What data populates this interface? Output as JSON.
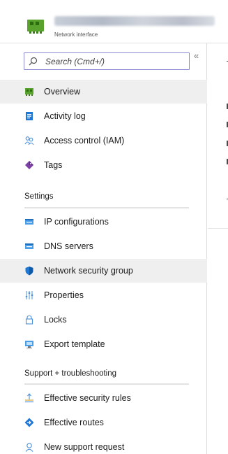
{
  "header": {
    "resource_type": "Network interface"
  },
  "search": {
    "placeholder": "Search (Cmd+/)"
  },
  "collapse_glyph": "«",
  "nav": {
    "items_top": [
      {
        "label": "Overview",
        "icon": "network-interface-icon"
      },
      {
        "label": "Activity log",
        "icon": "activity-log-icon"
      },
      {
        "label": "Access control (IAM)",
        "icon": "people-icon"
      },
      {
        "label": "Tags",
        "icon": "tag-icon"
      }
    ],
    "settings_title": "Settings",
    "settings_items": [
      {
        "label": "IP configurations",
        "icon": "ip-config-icon"
      },
      {
        "label": "DNS servers",
        "icon": "dns-icon"
      },
      {
        "label": "Network security group",
        "icon": "shield-icon"
      },
      {
        "label": "Properties",
        "icon": "properties-icon"
      },
      {
        "label": "Locks",
        "icon": "lock-icon"
      },
      {
        "label": "Export template",
        "icon": "export-icon"
      }
    ],
    "support_title": "Support + troubleshooting",
    "support_items": [
      {
        "label": "Effective security rules",
        "icon": "security-rules-icon"
      },
      {
        "label": "Effective routes",
        "icon": "routes-icon"
      },
      {
        "label": "New support request",
        "icon": "support-person-icon"
      }
    ]
  },
  "colors": {
    "accent_blue": "#1e78d6",
    "search_border": "#8a8ad4",
    "active_bg": "#efefef",
    "nic_green": "#5aa22e"
  }
}
